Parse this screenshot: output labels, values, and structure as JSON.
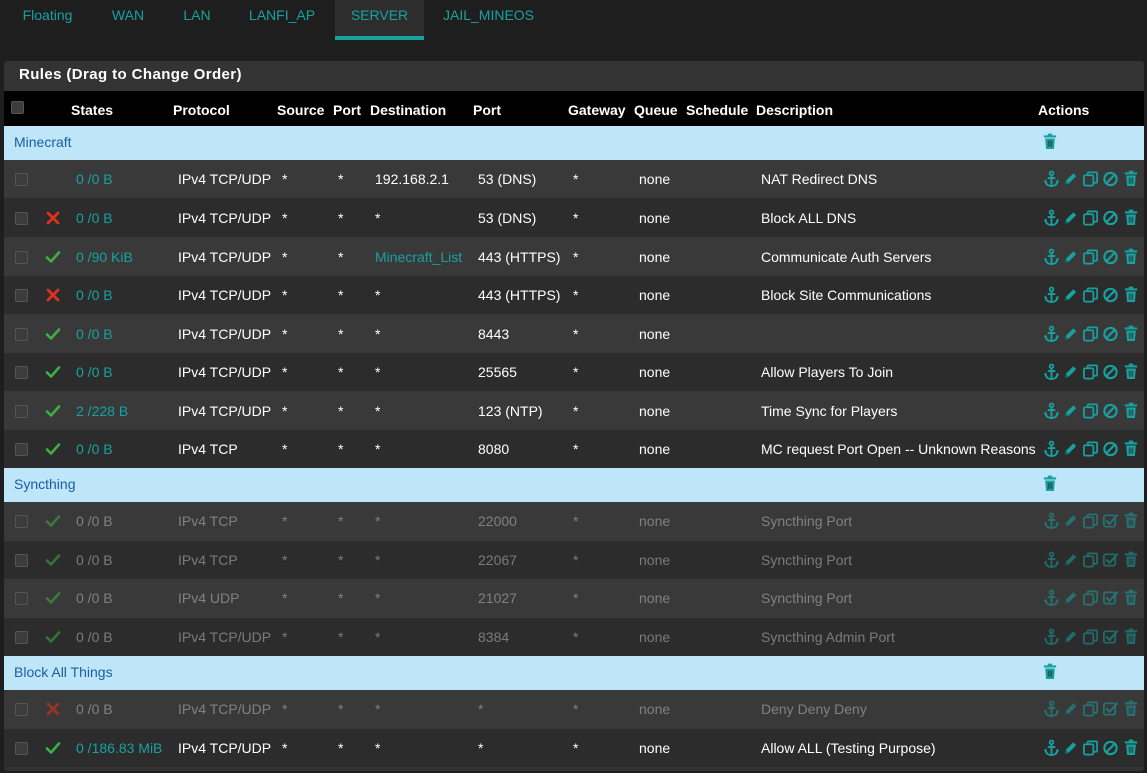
{
  "tabs": [
    {
      "label": "Floating",
      "active": false
    },
    {
      "label": "WAN",
      "active": false
    },
    {
      "label": "LAN",
      "active": false
    },
    {
      "label": "LANFI_AP",
      "active": false
    },
    {
      "label": "SERVER",
      "active": true
    },
    {
      "label": "JAIL_MINEOS",
      "active": false
    }
  ],
  "panel": {
    "title": "Rules (Drag to Change Order)"
  },
  "columns": {
    "states": "States",
    "protocol": "Protocol",
    "source": "Source",
    "port": "Port",
    "destination": "Destination",
    "dport": "Port",
    "gateway": "Gateway",
    "queue": "Queue",
    "schedule": "Schedule",
    "description": "Description",
    "actions": "Actions"
  },
  "colors": {
    "accent": "#17a2a1",
    "pass": "#3cb043",
    "block": "#e0301e",
    "separator": "#bee5f8",
    "separator_text": "#1a5fa5"
  },
  "groups": [
    {
      "name": "Minecraft",
      "rules": [
        {
          "status": "none",
          "states": "0 /0 B",
          "protocol": "IPv4 TCP/UDP",
          "source": "*",
          "sport": "*",
          "destination": "192.168.2.1",
          "dport": "53 (DNS)",
          "gateway": "*",
          "queue": "none",
          "description": "NAT Redirect DNS",
          "enabled": true,
          "dest_link": false
        },
        {
          "status": "block",
          "states": "0 /0 B",
          "protocol": "IPv4 TCP/UDP",
          "source": "*",
          "sport": "*",
          "destination": "*",
          "dport": "53 (DNS)",
          "gateway": "*",
          "queue": "none",
          "description": "Block ALL DNS",
          "enabled": true,
          "dest_link": false
        },
        {
          "status": "pass",
          "states": "0 /90 KiB",
          "protocol": "IPv4 TCP/UDP",
          "source": "*",
          "sport": "*",
          "destination": "Minecraft_List",
          "dport": "443 (HTTPS)",
          "gateway": "*",
          "queue": "none",
          "description": "Communicate Auth Servers",
          "enabled": true,
          "dest_link": true
        },
        {
          "status": "block",
          "states": "0 /0 B",
          "protocol": "IPv4 TCP/UDP",
          "source": "*",
          "sport": "*",
          "destination": "*",
          "dport": "443 (HTTPS)",
          "gateway": "*",
          "queue": "none",
          "description": "Block Site Communications",
          "enabled": true,
          "dest_link": false
        },
        {
          "status": "pass",
          "states": "0 /0 B",
          "protocol": "IPv4 TCP/UDP",
          "source": "*",
          "sport": "*",
          "destination": "*",
          "dport": "8443",
          "gateway": "*",
          "queue": "none",
          "description": "",
          "enabled": true,
          "dest_link": false
        },
        {
          "status": "pass",
          "states": "0 /0 B",
          "protocol": "IPv4 TCP/UDP",
          "source": "*",
          "sport": "*",
          "destination": "*",
          "dport": "25565",
          "gateway": "*",
          "queue": "none",
          "description": "Allow Players To Join",
          "enabled": true,
          "dest_link": false
        },
        {
          "status": "pass",
          "states": "2 /228 B",
          "protocol": "IPv4 TCP/UDP",
          "source": "*",
          "sport": "*",
          "destination": "*",
          "dport": "123 (NTP)",
          "gateway": "*",
          "queue": "none",
          "description": "Time Sync for Players",
          "enabled": true,
          "dest_link": false
        },
        {
          "status": "pass",
          "states": "0 /0 B",
          "protocol": "IPv4 TCP",
          "source": "*",
          "sport": "*",
          "destination": "*",
          "dport": "8080",
          "gateway": "*",
          "queue": "none",
          "description": "MC request Port Open -- Unknown Reasons",
          "enabled": true,
          "dest_link": false
        }
      ]
    },
    {
      "name": "Syncthing",
      "rules": [
        {
          "status": "pass",
          "states": "0 /0 B",
          "protocol": "IPv4 TCP",
          "source": "*",
          "sport": "*",
          "destination": "*",
          "dport": "22000",
          "gateway": "*",
          "queue": "none",
          "description": "Syncthing Port",
          "enabled": false,
          "dest_link": false
        },
        {
          "status": "pass",
          "states": "0 /0 B",
          "protocol": "IPv4 TCP",
          "source": "*",
          "sport": "*",
          "destination": "*",
          "dport": "22067",
          "gateway": "*",
          "queue": "none",
          "description": "Syncthing Port",
          "enabled": false,
          "dest_link": false
        },
        {
          "status": "pass",
          "states": "0 /0 B",
          "protocol": "IPv4 UDP",
          "source": "*",
          "sport": "*",
          "destination": "*",
          "dport": "21027",
          "gateway": "*",
          "queue": "none",
          "description": "Syncthing Port",
          "enabled": false,
          "dest_link": false
        },
        {
          "status": "pass",
          "states": "0 /0 B",
          "protocol": "IPv4 TCP/UDP",
          "source": "*",
          "sport": "*",
          "destination": "*",
          "dport": "8384",
          "gateway": "*",
          "queue": "none",
          "description": "Syncthing Admin Port",
          "enabled": false,
          "dest_link": false
        }
      ]
    },
    {
      "name": "Block All Things",
      "rules": [
        {
          "status": "block",
          "states": "0 /0 B",
          "protocol": "IPv4 TCP/UDP",
          "source": "*",
          "sport": "*",
          "destination": "*",
          "dport": "*",
          "gateway": "*",
          "queue": "none",
          "description": "Deny Deny Deny",
          "enabled": false,
          "dest_link": false
        },
        {
          "status": "pass",
          "states": "0 /186.83 MiB",
          "protocol": "IPv4 TCP/UDP",
          "source": "*",
          "sport": "*",
          "destination": "*",
          "dport": "*",
          "gateway": "*",
          "queue": "none",
          "description": "Allow ALL (Testing Purpose)",
          "enabled": true,
          "dest_link": false
        }
      ]
    }
  ]
}
